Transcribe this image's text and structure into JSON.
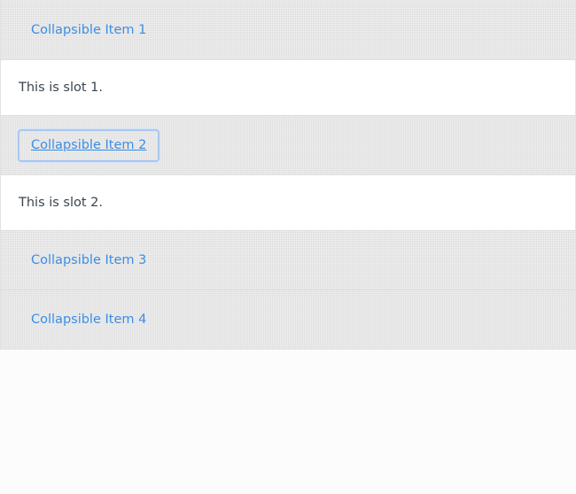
{
  "accordion": {
    "items": [
      {
        "title": "Collapsible Item 1",
        "expanded": true,
        "slot": "This is slot 1."
      },
      {
        "title": "Collapsible Item 2",
        "expanded": true,
        "focused": true,
        "slot": "This is slot 2."
      },
      {
        "title": "Collapsible Item 3",
        "expanded": false
      },
      {
        "title": "Collapsible Item 4",
        "expanded": false
      }
    ]
  },
  "colors": {
    "link": "#3b8ee6",
    "header_bg": "#efefef",
    "panel_bg": "#ffffff",
    "text": "#3a4550",
    "focus_ring": "#a8c8f0"
  }
}
